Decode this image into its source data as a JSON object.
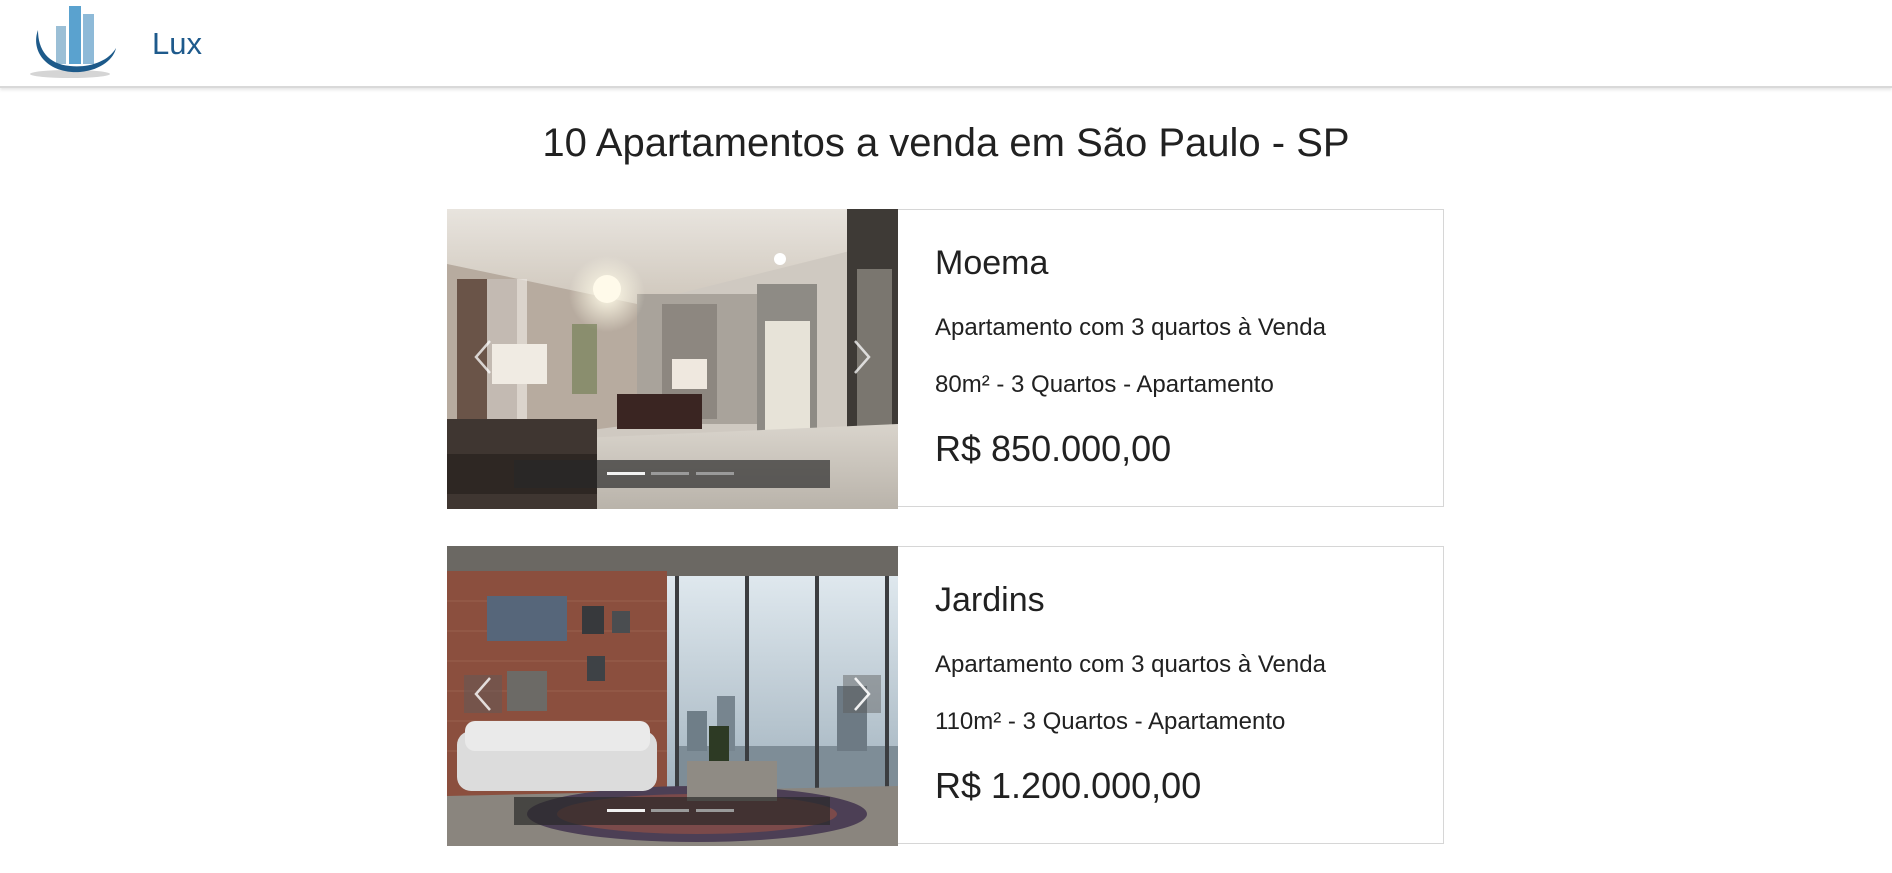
{
  "brand": {
    "name": "Lux",
    "color": "#1e5a8c"
  },
  "page": {
    "title": "10 Apartamentos a venda em São Paulo - SP"
  },
  "listings": [
    {
      "neighborhood": "Moema",
      "description": "Apartamento com 3 quartos à Venda",
      "features": "80m² - 3 Quartos - Apartamento",
      "price": "R$ 850.000,00",
      "photo": "modern living room with chandelier and hallway",
      "slides": 3,
      "active_slide": 1
    },
    {
      "neighborhood": "Jardins",
      "description": "Apartamento com 3 quartos à Venda",
      "features": "110m² - 3 Quartos - Apartamento",
      "price": "R$ 1.200.000,00",
      "photo": "living room with brick wall, white sofa and city view",
      "slides": 3,
      "active_slide": 1
    }
  ],
  "icons": {
    "prev": "chevron-left-icon",
    "next": "chevron-right-icon"
  }
}
